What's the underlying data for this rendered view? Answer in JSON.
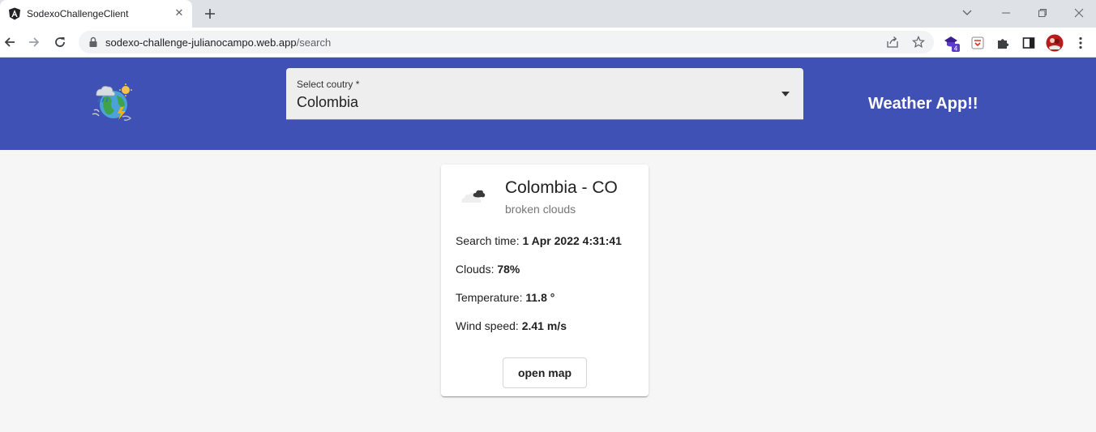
{
  "browser": {
    "tab_title": "SodexoChallengeClient",
    "url_host": "sodexo-challenge-julianocampo.web.app",
    "url_path": "/search",
    "extension_badge": "4",
    "icons": [
      "angular-favicon-icon",
      "close-icon",
      "new-tab-icon",
      "back-icon",
      "forward-icon",
      "reload-icon",
      "lock-icon",
      "share-icon",
      "bookmark-star-icon",
      "extension-icon",
      "puzzle-icon",
      "side-panel-icon",
      "profile-avatar-icon",
      "kebab-menu-icon",
      "minimize-icon",
      "restore-icon",
      "window-close-icon",
      "tab-search-icon"
    ]
  },
  "header": {
    "select_label": "Select coutry *",
    "selected_country": "Colombia",
    "app_title": "Weather App!!",
    "background": "#3f51b5"
  },
  "card": {
    "title": "Colombia - CO",
    "subtitle": "broken clouds",
    "search_time_label": "Search time:",
    "search_time_value": "1 Apr 2022 4:31:41",
    "clouds_label": "Clouds:",
    "clouds_value": "78%",
    "temperature_label": "Temperature:",
    "temperature_value": "11.8 °",
    "wind_label": "Wind speed:",
    "wind_value": "2.41 m/s",
    "button_label": "open map"
  }
}
